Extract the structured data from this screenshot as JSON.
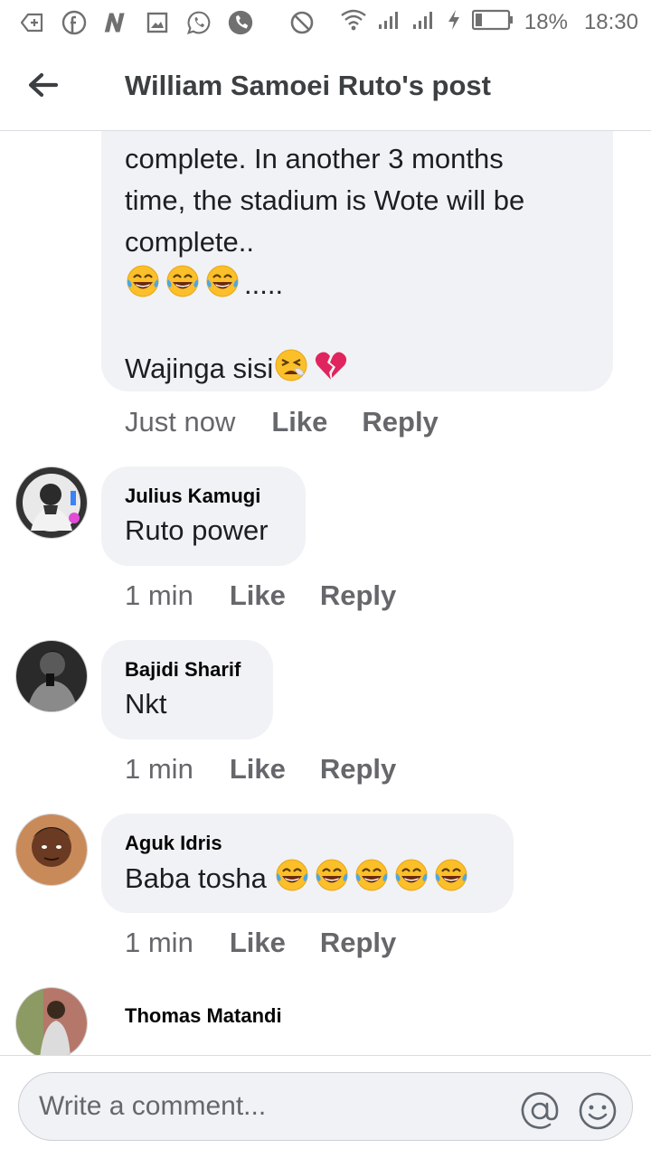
{
  "status_bar": {
    "battery": "18%",
    "time": "18:30"
  },
  "header": {
    "title": "William Samoei Ruto's post"
  },
  "first_comment": {
    "lines": [
      "complete. In another 3 months",
      "time, the stadium is Wote will be",
      "complete.."
    ],
    "dots": ".....",
    "last_line": "Wajinga sisi",
    "time": "Just now",
    "like": "Like",
    "reply": "Reply"
  },
  "comments": [
    {
      "author": "Julius Kamugi",
      "text": "Ruto power",
      "time": "1 min",
      "like": "Like",
      "reply": "Reply"
    },
    {
      "author": "Bajidi Sharif",
      "text": "Nkt",
      "time": "1 min",
      "like": "Like",
      "reply": "Reply"
    },
    {
      "author": "Aguk Idris",
      "text": "Baba tosha",
      "time": "1 min",
      "like": "Like",
      "reply": "Reply"
    },
    {
      "author": "Thomas Matandi"
    }
  ],
  "comment_bar": {
    "placeholder": "Write a comment..."
  },
  "icons": {
    "back": "back-arrow-icon",
    "mention": "at-sign-icon",
    "emoji": "smiley-icon",
    "laugh": "face-with-tears-of-joy-icon",
    "tired": "tired-face-icon",
    "heart": "broken-heart-icon"
  },
  "colors": {
    "bubble": "#f0f2f5",
    "meta": "#65676b",
    "emoji_yellow": "#fbbf2a",
    "tears": "#4aa8e8",
    "heart": "#e0245e"
  }
}
